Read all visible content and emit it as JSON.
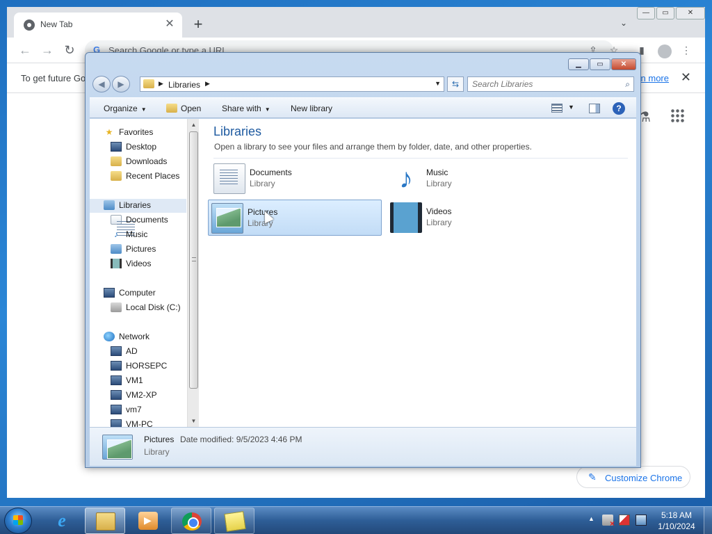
{
  "chrome": {
    "tab_title": "New Tab",
    "tab_close": "✕",
    "new_tab": "+",
    "tab_search": "⌄",
    "window_controls": {
      "minimize": "—",
      "maximize": "▭",
      "close": "✕"
    },
    "back": "←",
    "forward": "→",
    "reload": "↻",
    "omnibox_placeholder": "Search Google or type a URL",
    "omnibox_g": "G",
    "share_icon": "⇪",
    "bookmark_icon": "☆",
    "sidepanel_icon": "▮",
    "menu_icon": "⋮",
    "infobar_text": "To get future Go",
    "infobar_link": "rn more",
    "infobar_close": "✕",
    "labs_icon": "⚗",
    "customize_label": "Customize Chrome",
    "customize_icon": "✎"
  },
  "explorer": {
    "caption_buttons": {
      "minimize": "▁",
      "maximize": "▭",
      "close": "✕"
    },
    "back": "◀",
    "forward": "▶",
    "address": {
      "separator": "▶",
      "path": "Libraries",
      "trail_separator": "▶",
      "dropdown": "▼"
    },
    "refresh": "⇆",
    "search_placeholder": "Search Libraries",
    "search_icon": "⌕",
    "toolbar": {
      "organize": "Organize",
      "open": "Open",
      "share_with": "Share with",
      "new_library": "New library",
      "dropdown": "▼",
      "help": "?"
    },
    "nav": {
      "favorites": "Favorites",
      "desktop": "Desktop",
      "downloads": "Downloads",
      "recent_places": "Recent Places",
      "libraries": "Libraries",
      "documents": "Documents",
      "music": "Music",
      "pictures": "Pictures",
      "videos": "Videos",
      "computer": "Computer",
      "local_disk": "Local Disk (C:)",
      "network": "Network",
      "net_ad": "AD",
      "net_horsepc": "HORSEPC",
      "net_vm1": "VM1",
      "net_vm2xp": "VM2-XP",
      "net_vm7": "vm7",
      "net_vmpc": "VM-PC"
    },
    "scroll": {
      "up": "▲",
      "down": "▼"
    },
    "content": {
      "heading": "Libraries",
      "subheading": "Open a library to see your files and arrange them by folder, date, and other properties.",
      "libraries": [
        {
          "name": "Documents",
          "type": "Library"
        },
        {
          "name": "Music",
          "type": "Library"
        },
        {
          "name": "Pictures",
          "type": "Library"
        },
        {
          "name": "Videos",
          "type": "Library"
        }
      ]
    },
    "status": {
      "name": "Pictures",
      "modified": "Date modified: 9/5/2023 4:46 PM",
      "type": "Library"
    }
  },
  "taskbar": {
    "tray_up": "▲",
    "time": "5:18 AM",
    "date": "1/10/2024"
  },
  "icons": {
    "music_note": "♪",
    "star": "★"
  }
}
